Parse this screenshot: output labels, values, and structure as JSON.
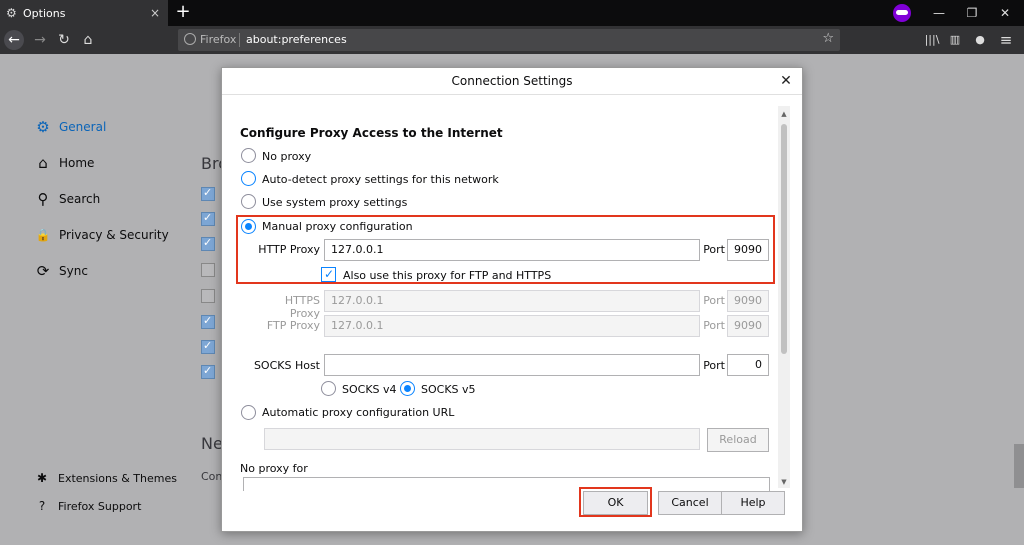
{
  "tab": {
    "title": "Options",
    "close": "×"
  },
  "toolbar": {
    "new_tab": "+",
    "back": "←",
    "forward": "→",
    "reload": "↻",
    "home": "⌂",
    "minimize": "—",
    "restore": "❐",
    "close": "✕",
    "library": "|||\\",
    "sidebar": "▥",
    "account": "●",
    "menu": "≡",
    "bookmark_star": "☆"
  },
  "urlbar": {
    "brand": "Firefox",
    "url": "about:preferences"
  },
  "sidebar": {
    "items": [
      {
        "label": "General",
        "icon": "⚙"
      },
      {
        "label": "Home",
        "icon": "⌂"
      },
      {
        "label": "Search",
        "icon": "⚲"
      },
      {
        "label": "Privacy & Security",
        "icon": "🔒"
      },
      {
        "label": "Sync",
        "icon": "⟳"
      }
    ],
    "footer": [
      {
        "label": "Extensions & Themes",
        "icon": "✱"
      },
      {
        "label": "Firefox Support",
        "icon": "?"
      }
    ]
  },
  "background": {
    "heading1": "Bro",
    "heading2": "Ne",
    "con": "Con"
  },
  "dialog": {
    "title": "Connection Settings",
    "close": "✕",
    "section_title": "Configure Proxy Access to the Internet",
    "options": {
      "no_proxy": "No proxy",
      "auto_detect": "Auto-detect proxy settings for this network",
      "system": "Use system proxy settings",
      "manual": "Manual proxy configuration",
      "auto_url": "Automatic proxy configuration URL"
    },
    "http": {
      "label": "HTTP Proxy",
      "value": "127.0.0.1",
      "port_label": "Port",
      "port": "9090"
    },
    "also_use": "Also use this proxy for FTP and HTTPS",
    "https": {
      "label": "HTTPS Proxy",
      "value": "127.0.0.1",
      "port_label": "Port",
      "port": "9090"
    },
    "ftp": {
      "label": "FTP Proxy",
      "value": "127.0.0.1",
      "port_label": "Port",
      "port": "9090"
    },
    "socks": {
      "label": "SOCKS Host",
      "value": "",
      "port_label": "Port",
      "port": "0",
      "v4": "SOCKS v4",
      "v5": "SOCKS v5"
    },
    "pac_url": "",
    "reload": "Reload",
    "no_proxy_for": "No proxy for",
    "buttons": {
      "ok": "OK",
      "cancel": "Cancel",
      "help": "Help"
    }
  }
}
